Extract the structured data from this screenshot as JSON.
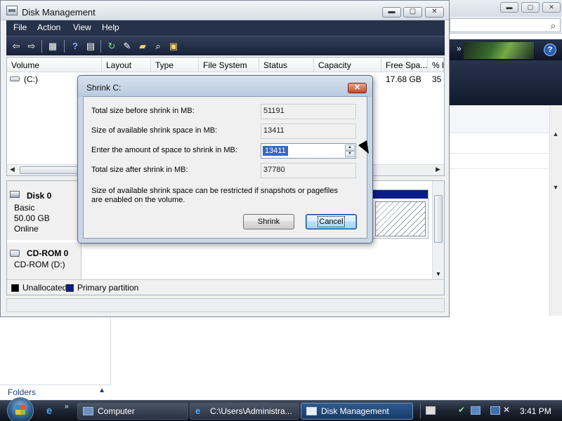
{
  "window": {
    "title": "Disk Management",
    "controls": {
      "minimize": "▬",
      "maximize": "▢",
      "close": "✕"
    }
  },
  "menu": [
    "File",
    "Action",
    "View",
    "Help"
  ],
  "toolbar_icons": [
    "back-icon",
    "forward-icon",
    "show-hide-console-tree-icon",
    "help-icon",
    "properties-icon",
    "refresh-icon",
    "rescan-icon",
    "open-icon",
    "explore-icon",
    "settings-icon"
  ],
  "volume_list": {
    "columns": [
      "Volume",
      "Layout",
      "Type",
      "File System",
      "Status",
      "Capacity",
      "Free Spa...",
      "% F"
    ],
    "rows": [
      {
        "volume": "(C:)",
        "free_space": "17.68 GB",
        "percent_free": "35"
      }
    ]
  },
  "disks": [
    {
      "name": "Disk 0",
      "lines": [
        "Basic",
        "50.00 GB",
        "Online"
      ]
    },
    {
      "name": "CD-ROM 0",
      "lines": [
        "CD-ROM (D:)"
      ]
    }
  ],
  "legend": [
    {
      "label": "Unallocated",
      "color": "#000000"
    },
    {
      "label": "Primary partition",
      "color": "#0c1b8a"
    }
  ],
  "dialog": {
    "title": "Shrink C:",
    "close_glyph": "✕",
    "fields": [
      {
        "label": "Total size before shrink in MB:",
        "value": "51191"
      },
      {
        "label": "Size of available shrink space in MB:",
        "value": "13411"
      },
      {
        "label": "Enter the amount of space to shrink in MB:",
        "value": "13411"
      },
      {
        "label": "Total size after shrink in MB:",
        "value": "37780"
      }
    ],
    "note_line1": "Size of available shrink space can be restricted if snapshots or pagefiles",
    "note_line2": "are enabled on the volume.",
    "shrink_button": "Shrink",
    "cancel_button": "Cancel"
  },
  "background_window": {
    "folders_label": "Folders",
    "search_icon": "⌕",
    "help_glyph": "?",
    "chevron": "»"
  },
  "taskbar": {
    "items": [
      {
        "label": "Computer"
      },
      {
        "label": "C:\\Users\\Administra..."
      },
      {
        "label": "Disk Management"
      }
    ],
    "quick_launch_more": "»",
    "clock": "3:41 PM"
  }
}
